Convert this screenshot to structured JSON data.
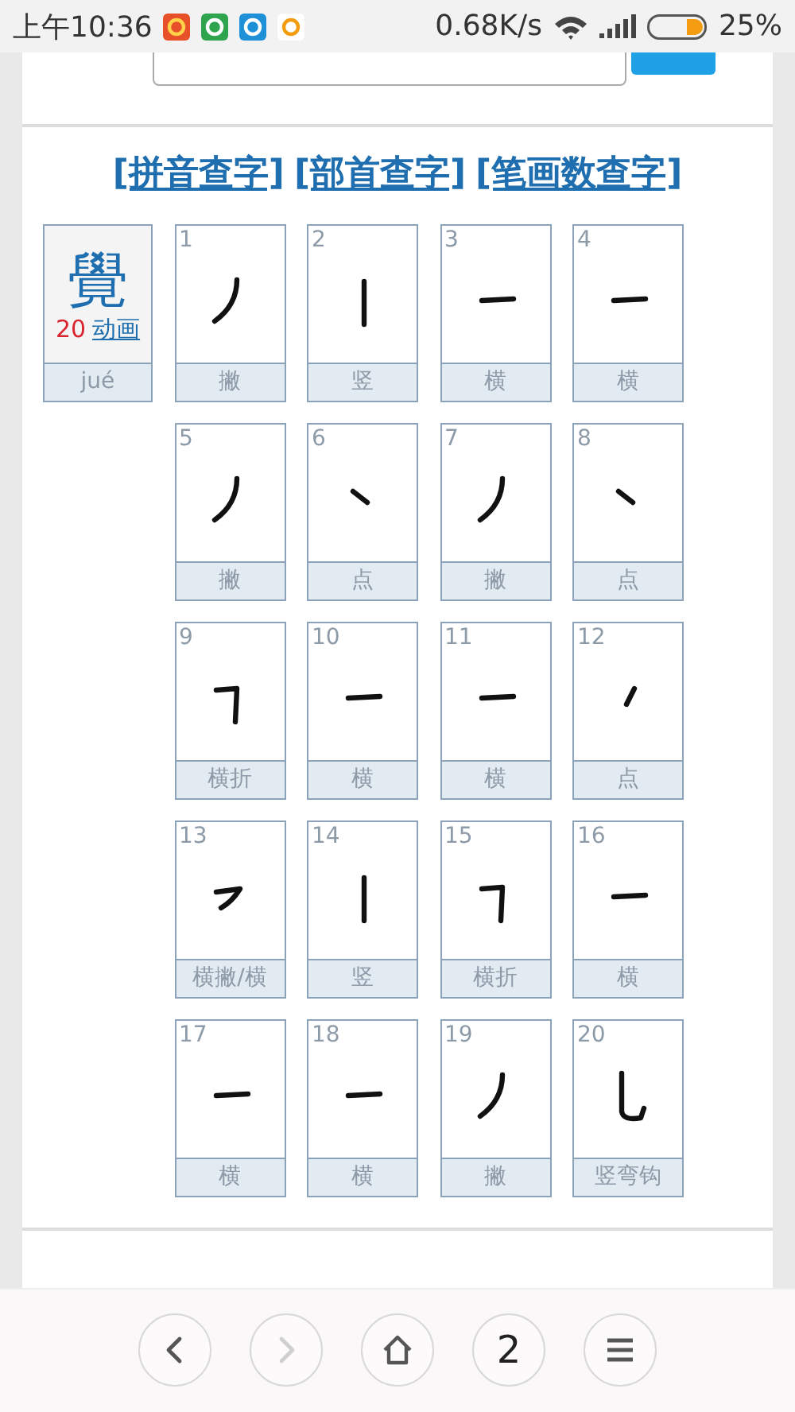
{
  "status_bar": {
    "time": "上午10:36",
    "net_speed": "0.68K/s",
    "battery": "25%"
  },
  "lookup_links": [
    "[拼音查字]",
    "[部首查字]",
    "[笔画数查字]"
  ],
  "character": {
    "glyph": "覺",
    "stroke_count": "20",
    "animation_link": "动画",
    "pinyin": "jué"
  },
  "strokes": [
    {
      "number": "1",
      "name": "撇",
      "kind": "pie"
    },
    {
      "number": "2",
      "name": "竖",
      "kind": "shu"
    },
    {
      "number": "3",
      "name": "横",
      "kind": "heng"
    },
    {
      "number": "4",
      "name": "横",
      "kind": "heng"
    },
    {
      "number": "5",
      "name": "撇",
      "kind": "pie"
    },
    {
      "number": "6",
      "name": "点",
      "kind": "dian"
    },
    {
      "number": "7",
      "name": "撇",
      "kind": "pie"
    },
    {
      "number": "8",
      "name": "点",
      "kind": "dian"
    },
    {
      "number": "9",
      "name": "横折",
      "kind": "hengzhe"
    },
    {
      "number": "10",
      "name": "横",
      "kind": "heng"
    },
    {
      "number": "11",
      "name": "横",
      "kind": "heng"
    },
    {
      "number": "12",
      "name": "点",
      "kind": "dianleft"
    },
    {
      "number": "13",
      "name": "横撇/横",
      "kind": "hengpie"
    },
    {
      "number": "14",
      "name": "竖",
      "kind": "shu"
    },
    {
      "number": "15",
      "name": "横折",
      "kind": "hengzhe"
    },
    {
      "number": "16",
      "name": "横",
      "kind": "heng"
    },
    {
      "number": "17",
      "name": "横",
      "kind": "heng"
    },
    {
      "number": "18",
      "name": "横",
      "kind": "heng"
    },
    {
      "number": "19",
      "name": "撇",
      "kind": "pie"
    },
    {
      "number": "20",
      "name": "竖弯钩",
      "kind": "shuwangou"
    }
  ],
  "bottom_nav": [
    {
      "kind": "back",
      "disabled": false
    },
    {
      "kind": "forward",
      "disabled": true
    },
    {
      "kind": "home",
      "disabled": false
    },
    {
      "kind": "tabs",
      "label": "2",
      "disabled": false
    },
    {
      "kind": "menu",
      "disabled": false
    }
  ]
}
